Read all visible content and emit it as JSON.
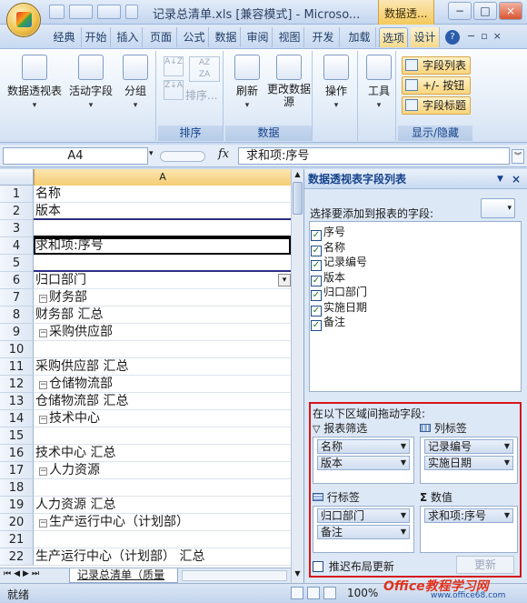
{
  "title": {
    "text": "记录总清单.xls  [兼容模式] - Microso...",
    "context_tab": "数据透..."
  },
  "window_buttons": [
    "−",
    "□",
    "×"
  ],
  "tabs": [
    "经典",
    "开始",
    "插入",
    "页面",
    "公式",
    "数据",
    "审阅",
    "视图",
    "开发",
    "加载",
    "选项",
    "设计"
  ],
  "ribbon": {
    "groups": {
      "pivot": {
        "label": "数据透视表"
      },
      "active_field": {
        "label": "活动字段"
      },
      "group": {
        "label": "分组"
      },
      "sort": {
        "sort_label": "排序...",
        "group_label": "排序"
      },
      "data": {
        "refresh_label": "刷新",
        "change_source_label": "更改数据源",
        "group_label": "数据"
      },
      "actions": {
        "label": "操作"
      },
      "tools": {
        "label": "工具"
      },
      "showhide": {
        "field_list": "字段列表",
        "buttons": "+/- 按钮",
        "headers": "字段标题",
        "group_label": "显示/隐藏"
      }
    }
  },
  "formula_bar": {
    "name_box": "A4",
    "fx": "fx",
    "value": "求和项:序号"
  },
  "sheet": {
    "column_header": "A",
    "rows": [
      {
        "n": "1",
        "text": "名称"
      },
      {
        "n": "2",
        "text": "版本"
      },
      {
        "n": "3",
        "text": ""
      },
      {
        "n": "4",
        "text": "求和项:序号"
      },
      {
        "n": "5",
        "text": ""
      },
      {
        "n": "6",
        "text": "归口部门"
      },
      {
        "n": "7",
        "text": "财务部"
      },
      {
        "n": "8",
        "text": "财务部 汇总"
      },
      {
        "n": "9",
        "text": "采购供应部"
      },
      {
        "n": "10",
        "text": ""
      },
      {
        "n": "11",
        "text": "采购供应部 汇总"
      },
      {
        "n": "12",
        "text": "仓储物流部"
      },
      {
        "n": "13",
        "text": "仓储物流部 汇总"
      },
      {
        "n": "14",
        "text": "技术中心"
      },
      {
        "n": "15",
        "text": ""
      },
      {
        "n": "16",
        "text": "技术中心 汇总"
      },
      {
        "n": "17",
        "text": "人力资源"
      },
      {
        "n": "18",
        "text": ""
      },
      {
        "n": "19",
        "text": "人力资源 汇总"
      },
      {
        "n": "20",
        "text": "生产运行中心（计划部）"
      },
      {
        "n": "21",
        "text": ""
      },
      {
        "n": "22",
        "text": "生产运行中心（计划部） 汇总"
      }
    ],
    "sheet_tab": "记录总清单（质量"
  },
  "status": {
    "ready": "就绪",
    "zoom": "100%",
    "watermark": "Office教程学习网",
    "watermark_url": "www.office68.com"
  },
  "pane": {
    "title": "数据透视表字段列表",
    "choose_label": "选择要添加到报表的字段:",
    "fields": [
      "序号",
      "名称",
      "记录编号",
      "版本",
      "归口部门",
      "实施日期",
      "备注"
    ],
    "drag_label": "在以下区域间拖动字段:",
    "report_filter": {
      "label": "报表筛选",
      "items": [
        "名称",
        "版本"
      ]
    },
    "column_labels": {
      "label": "列标签",
      "items": [
        "记录编号",
        "实施日期"
      ]
    },
    "row_labels": {
      "label": "行标签",
      "items": [
        "归口部门",
        "备注"
      ]
    },
    "values": {
      "label": "数值",
      "items": [
        "求和项:序号"
      ]
    },
    "defer_label": "推迟布局更新",
    "update_button": "更新"
  }
}
